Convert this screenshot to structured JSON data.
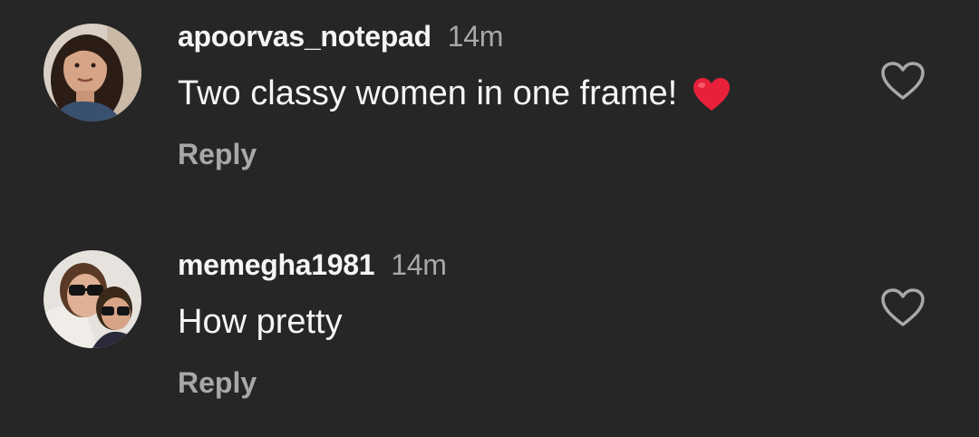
{
  "comments": [
    {
      "username": "apoorvas_notepad",
      "time": "14m",
      "text": "Two classy women in one frame!",
      "emoji": "red-heart",
      "reply_label": "Reply",
      "like_icon": "heart-outline-icon"
    },
    {
      "username": "memegha1981",
      "time": "14m",
      "text": "How pretty",
      "reply_label": "Reply",
      "like_icon": "heart-outline-icon"
    }
  ],
  "colors": {
    "background": "#262626",
    "primary_text": "#f5f5f5",
    "secondary_text": "#a8a8a8",
    "heart_red": "#e8203a"
  }
}
